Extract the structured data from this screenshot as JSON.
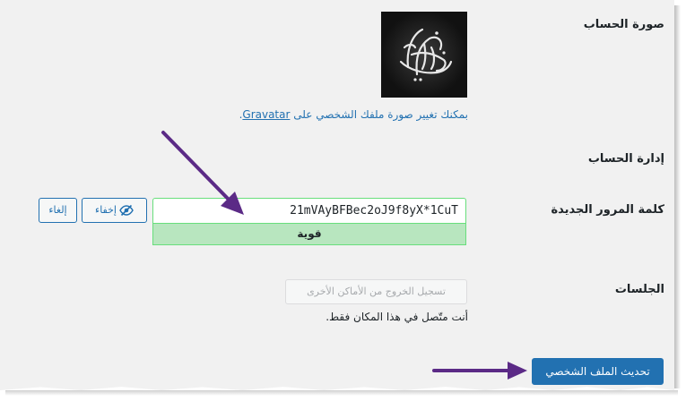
{
  "labels": {
    "avatar": "صورة الحساب",
    "account_management": "إدارة الحساب",
    "new_password": "كلمة المرور الجديدة",
    "sessions": "الجلسات"
  },
  "avatar": {
    "caption_prefix": "بمكنك تغيير صورة ملفك الشخصي على ",
    "caption_link": "Gravatar",
    "caption_suffix": "."
  },
  "password": {
    "value": "21mVAyBFBec2oJ9f8yX*1CuT",
    "strength": "قوية",
    "hide_label": "إخفاء",
    "cancel_label": "إلغاء"
  },
  "sessions": {
    "logout_everywhere_label": "تسجيل الخروج من الأماكن الأخرى",
    "note": "أنت متّصل في هذا المكان فقط."
  },
  "update_profile_label": "تحديث الملف الشخصي",
  "colors": {
    "primary": "#2271b1",
    "strength_bg": "#b8e6bf",
    "strength_border": "#68de7c",
    "arrow": "#5b2a86"
  },
  "icons": {
    "hide": "eye-slash-icon"
  }
}
